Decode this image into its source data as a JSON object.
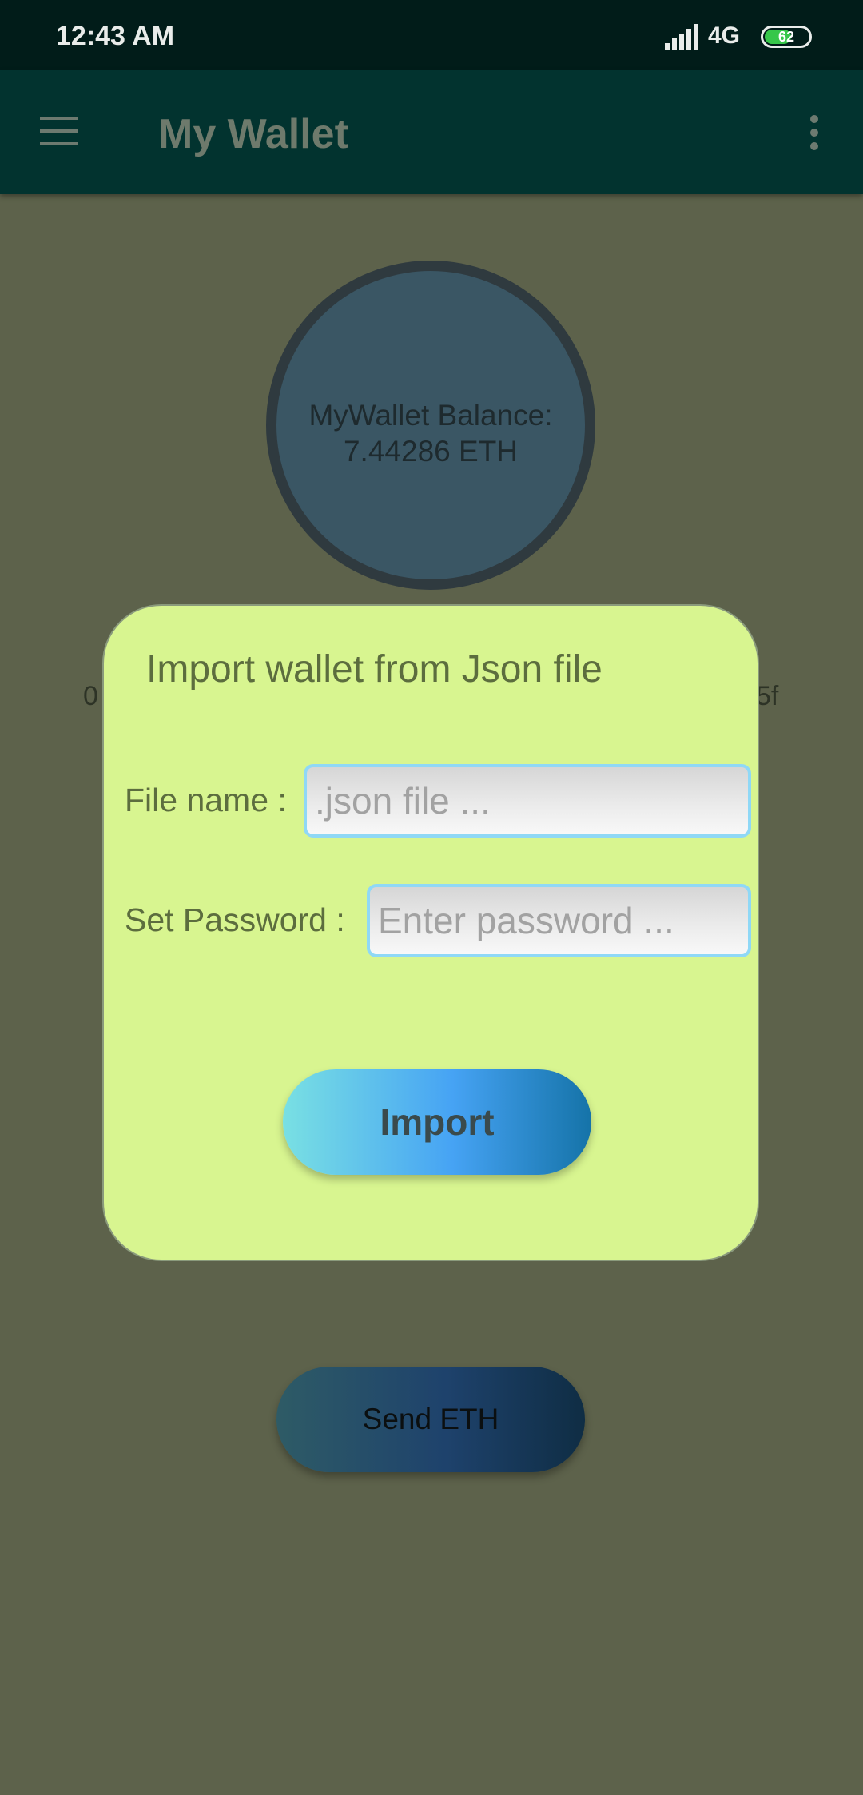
{
  "status_bar": {
    "time": "12:43 AM",
    "network": "4G",
    "battery": "62",
    "battery_level": 0.62,
    "icons": [
      "signal-icon",
      "battery-icon"
    ]
  },
  "app_bar": {
    "title": "My Wallet",
    "icons": [
      "menu-icon",
      "more-vert-icon"
    ]
  },
  "balance": {
    "label": "MyWallet Balance:",
    "value": "7.44286 ETH"
  },
  "address": {
    "left_visible": "0",
    "right_visible": "5f"
  },
  "dialog": {
    "title": "Import wallet from Json file",
    "file_label": "File name :",
    "file_placeholder": ".json file ...",
    "file_value": "",
    "password_label": "Set Password :",
    "password_placeholder": "Enter password ...",
    "password_value": "",
    "import_label": "Import"
  },
  "send_button": {
    "label": "Send ETH"
  },
  "colors": {
    "status_bar": "#011c19",
    "app_bar": "#02332f",
    "background": "#5d624b",
    "dialog": "#d8f590",
    "dialog_text": "#5c6d3e",
    "input_border": "#8fd8f6"
  }
}
